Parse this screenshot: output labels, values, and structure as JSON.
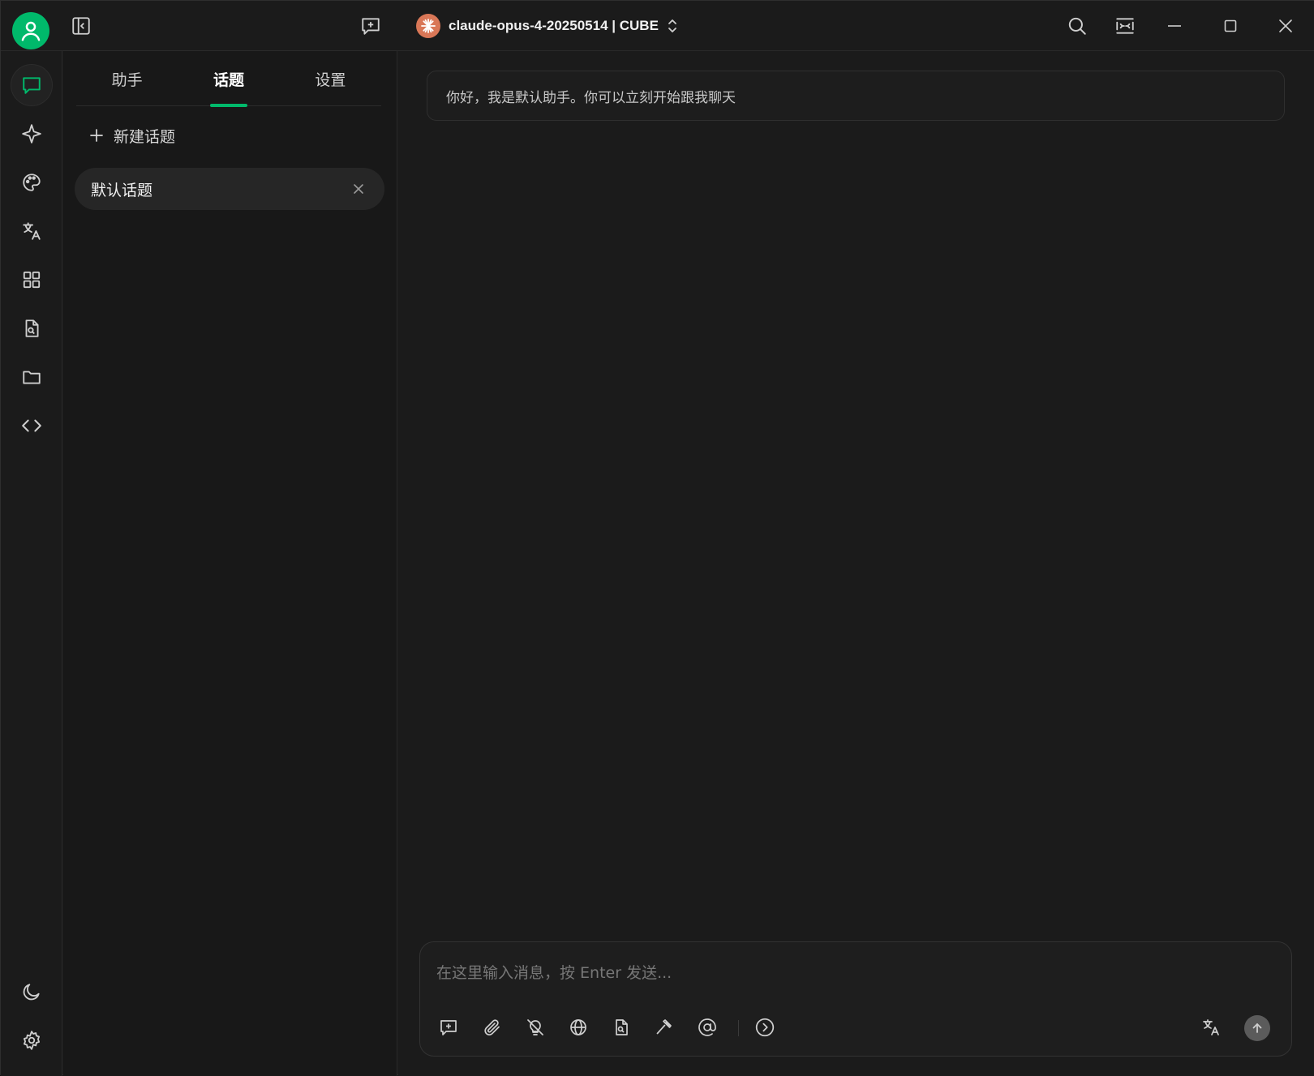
{
  "titlebar": {
    "model_name": "claude-opus-4-20250514 | CUBE"
  },
  "sidebar_rail": {
    "items": [
      {
        "icon": "chat-icon",
        "active": true
      },
      {
        "icon": "sparkle-icon"
      },
      {
        "icon": "palette-icon"
      },
      {
        "icon": "translate-icon"
      },
      {
        "icon": "apps-grid-icon"
      },
      {
        "icon": "file-search-icon"
      },
      {
        "icon": "folder-icon"
      },
      {
        "icon": "code-icon"
      }
    ],
    "bottom": [
      {
        "icon": "moon-icon"
      },
      {
        "icon": "settings-gear-icon"
      }
    ]
  },
  "panel": {
    "tabs": [
      {
        "label": "助手"
      },
      {
        "label": "话题",
        "active": true
      },
      {
        "label": "设置"
      }
    ],
    "new_topic_label": "新建话题",
    "topics": [
      {
        "label": "默认话题"
      }
    ]
  },
  "chat": {
    "greeting": "你好，我是默认助手。你可以立刻开始跟我聊天",
    "input_placeholder": "在这里输入消息，按 Enter 发送..."
  },
  "colors": {
    "accent": "#00b96b",
    "background": "#1b1b1b",
    "model_logo": "#d97757"
  }
}
